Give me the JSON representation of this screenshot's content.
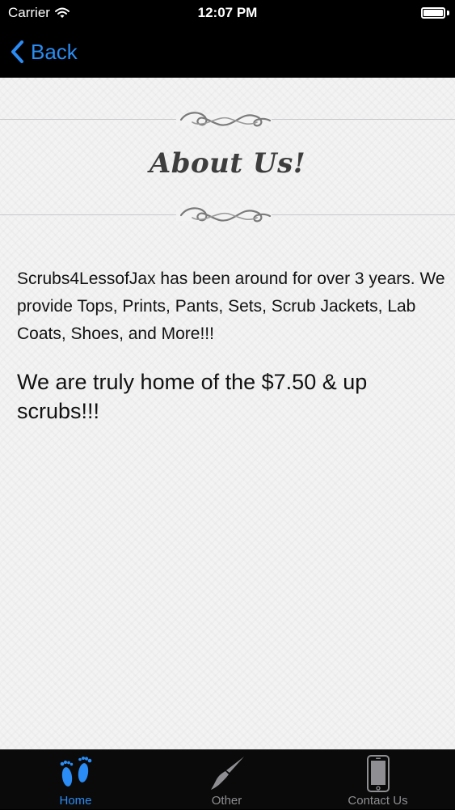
{
  "status_bar": {
    "carrier": "Carrier",
    "time": "12:07 PM"
  },
  "nav": {
    "back_label": "Back"
  },
  "content": {
    "heading": "About Us!",
    "paragraph1": "Scrubs4LessofJax has been around for over 3 years.  We provide Tops, Prints, Pants, Sets, Scrub Jackets, Lab Coats, Shoes, and More!!!",
    "paragraph2": "We are truly home of the $7.50 & up scrubs!!!"
  },
  "tabs": [
    {
      "label": "Home",
      "icon": "footprints-icon",
      "active": true
    },
    {
      "label": "Other",
      "icon": "paintbrush-icon",
      "active": false
    },
    {
      "label": "Contact Us",
      "icon": "phone-icon",
      "active": false
    }
  ],
  "colors": {
    "accent": "#2a8cf4",
    "inactive_tab": "#8e8e93",
    "content_bg": "#f3f3f4",
    "bar_bg": "#000000"
  }
}
